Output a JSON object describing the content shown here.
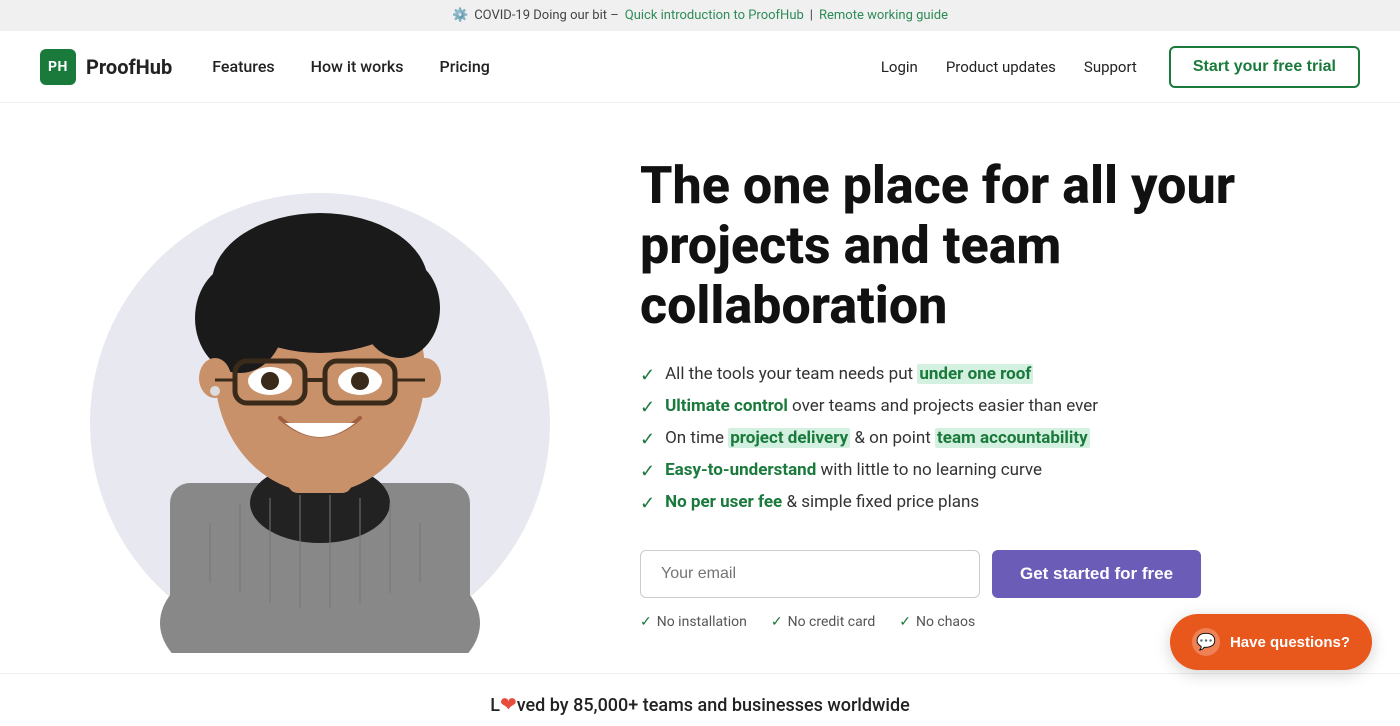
{
  "banner": {
    "prefix": "COVID-19 Doing our bit –",
    "link1_text": "Quick introduction to ProofHub",
    "pipe": "|",
    "link2_text": "Remote working guide"
  },
  "nav": {
    "logo_text": "PH",
    "brand_name": "ProofHub",
    "links": [
      {
        "label": "Features"
      },
      {
        "label": "How it works"
      },
      {
        "label": "Pricing"
      }
    ],
    "right_links": [
      {
        "label": "Login"
      },
      {
        "label": "Product updates"
      },
      {
        "label": "Support"
      }
    ],
    "cta_label": "Start your free trial"
  },
  "hero": {
    "title": "The one place for all your projects and team collaboration",
    "bullets": [
      {
        "text_before": "All the tools your team needs put ",
        "highlight": "under one roof",
        "text_after": ""
      },
      {
        "text_before": "",
        "highlight": "Ultimate control",
        "text_after": " over teams and projects easier than ever"
      },
      {
        "text_before": "On time ",
        "highlight": "project delivery",
        "text_mid": " & on point ",
        "highlight2": "team accountability",
        "text_after": ""
      },
      {
        "text_before": "",
        "highlight": "Easy-to-understand",
        "text_after": " with little to no learning curve"
      },
      {
        "text_before": "",
        "highlight": "No per user fee",
        "text_after": " & simple fixed price plans"
      }
    ],
    "email_placeholder": "Your email",
    "cta_button": "Get started for free",
    "meta": [
      "No installation",
      "No credit card",
      "No chaos"
    ]
  },
  "loved_bar": {
    "text_before": "L",
    "heart": "❤",
    "text_after": "ved by 85,000+ teams and businesses worldwide"
  },
  "chat": {
    "label": "Have questions?"
  }
}
